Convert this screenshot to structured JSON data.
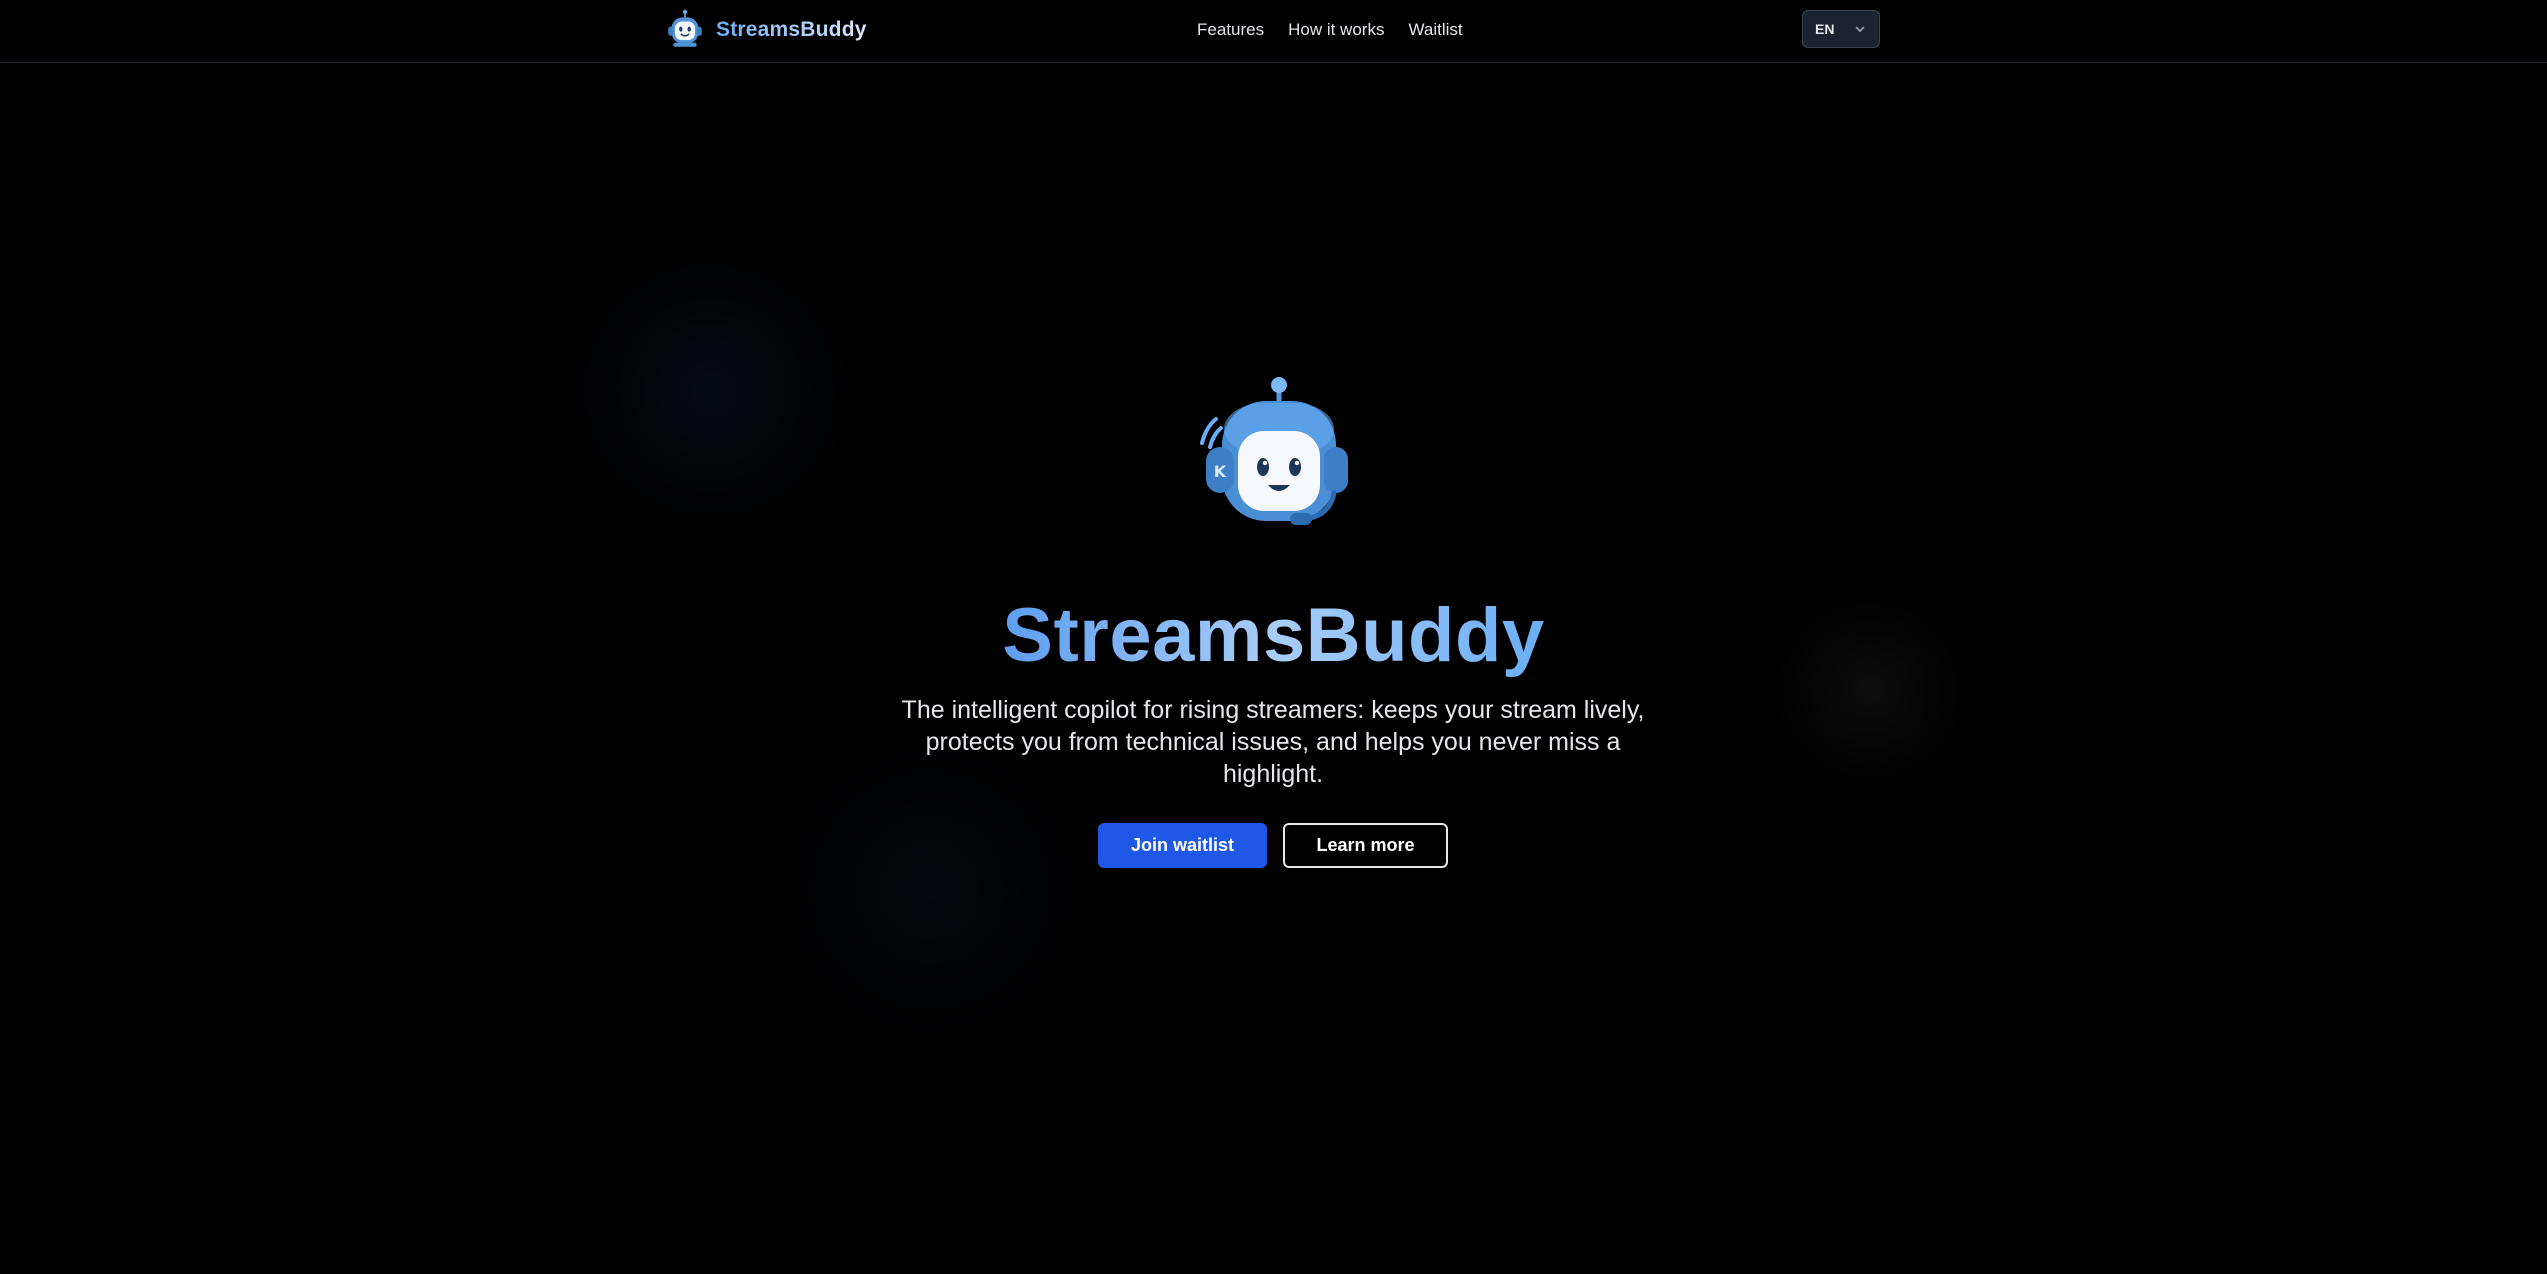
{
  "header": {
    "brand_name": "StreamsBuddy",
    "nav": {
      "features": "Features",
      "how_it_works": "How it works",
      "waitlist": "Waitlist"
    },
    "language": {
      "selected": "EN",
      "icon": "chevron-down-icon"
    }
  },
  "hero": {
    "mascot_icon": "robot-mascot-icon",
    "title": "StreamsBuddy",
    "subtitle": "The intelligent copilot for rising streamers: keeps your stream lively, protects you from technical issues, and helps you never miss a highlight.",
    "primary_cta": "Join waitlist",
    "secondary_cta": "Learn more"
  },
  "colors": {
    "background": "#000000",
    "accent_blue": "#1f57e6",
    "brand_gradient_start": "#5d9ef0",
    "brand_gradient_end": "#dbe9ff",
    "header_border": "#1f2937"
  }
}
